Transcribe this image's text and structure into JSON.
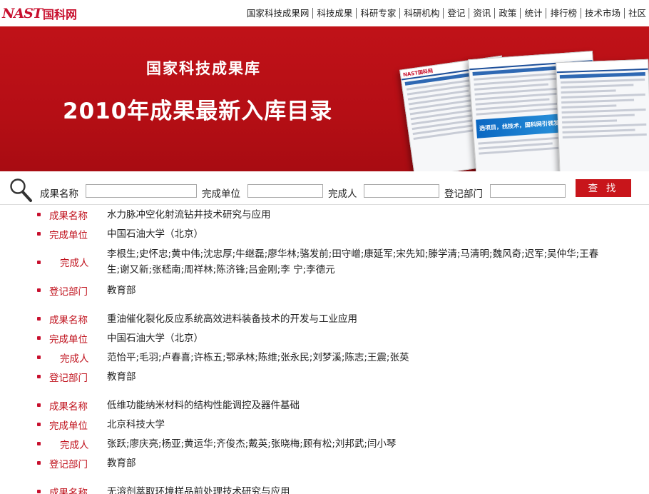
{
  "header": {
    "logo_en": "NAST",
    "logo_cn": "国科网",
    "nav": [
      "国家科技成果网",
      "科技成果",
      "科研专家",
      "科研机构",
      "登记",
      "资讯",
      "政策",
      "统计",
      "排行榜",
      "技术市场",
      "社区"
    ]
  },
  "banner": {
    "subtitle": "国家科技成果库",
    "title": "2010年成果最新入库目录",
    "collage_logo": "NAST国科网",
    "collage_slogan": "选项目，找技术，国科网引领发展新机遇"
  },
  "search": {
    "fields": [
      {
        "label": "成果名称",
        "value": ""
      },
      {
        "label": "完成单位",
        "value": ""
      },
      {
        "label": "完成人",
        "value": ""
      },
      {
        "label": "登记部门",
        "value": ""
      }
    ],
    "button": "查 找"
  },
  "labels": {
    "name": "成果名称",
    "unit": "完成单位",
    "people": "完成人",
    "dept": "登记部门"
  },
  "records": [
    {
      "name": "水力脉冲空化射流钻井技术研究与应用",
      "unit": "中国石油大学（北京）",
      "people": "李根生;史怀忠;黄中伟;沈忠厚;牛继磊;廖华林;骆发前;田守嶒;康延军;宋先知;滕学清;马清明;魏风奇;迟军;吴仲华;王春生;谢又新;张嵇南;周祥林;陈济锋;吕金刚;李 宁;李德元",
      "dept": "教育部"
    },
    {
      "name": "重油催化裂化反应系统高效进料装备技术的开发与工业应用",
      "unit": "中国石油大学（北京）",
      "people": "范怡平;毛羽;卢春喜;许栋五;鄂承林;陈维;张永民;刘梦溪;陈志;王震;张英",
      "dept": "教育部"
    },
    {
      "name": "低维功能纳米材料的结构性能调控及器件基础",
      "unit": "北京科技大学",
      "people": "张跃;廖庆亮;杨亚;黄运华;齐俊杰;戴英;张晓梅;顾有松;刘邦武;闫小琴",
      "dept": "教育部"
    },
    {
      "name": "无溶剂萃取环境样品前处理技术研究与应用"
    }
  ]
}
